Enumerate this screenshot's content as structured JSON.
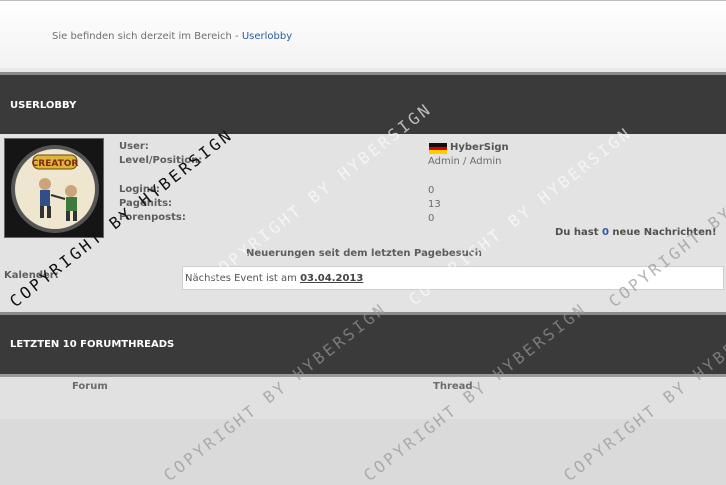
{
  "breadcrumb": {
    "prefix": "Sie befinden sich derzeit im Bereich - ",
    "link": "Userlobby"
  },
  "sections": {
    "userlobby": "USERLOBBY",
    "threads": "LETZTEN 10 FORUMTHREADS"
  },
  "profile": {
    "user_label": "User:",
    "level_label": "Level/Position:",
    "logins_label": "Logins:",
    "pagehits_label": "Pagehits:",
    "posts_label": "Forenposts:",
    "username": "HyberSign",
    "level_value": "Admin / Admin",
    "logins_value": "0",
    "pagehits_value": "13",
    "posts_value": "0",
    "avatar_text": "CREATOR"
  },
  "messages": {
    "prefix": "Du hast ",
    "count": "0",
    "suffix": " neue Nachrichten!"
  },
  "changes_text": "Neuerungen seit dem letzten Pagebesuch",
  "calendar": {
    "label": "Kalender:",
    "text": "Nächstes Event ist am ",
    "date": "03.04.2013"
  },
  "table_headers": {
    "forum": "Forum",
    "thread": "Thread"
  },
  "watermark": "COPYRIGHT BY HYBERSIGN",
  "colors": {
    "link": "#2a5a9e",
    "bar": "#3a3a3a"
  }
}
